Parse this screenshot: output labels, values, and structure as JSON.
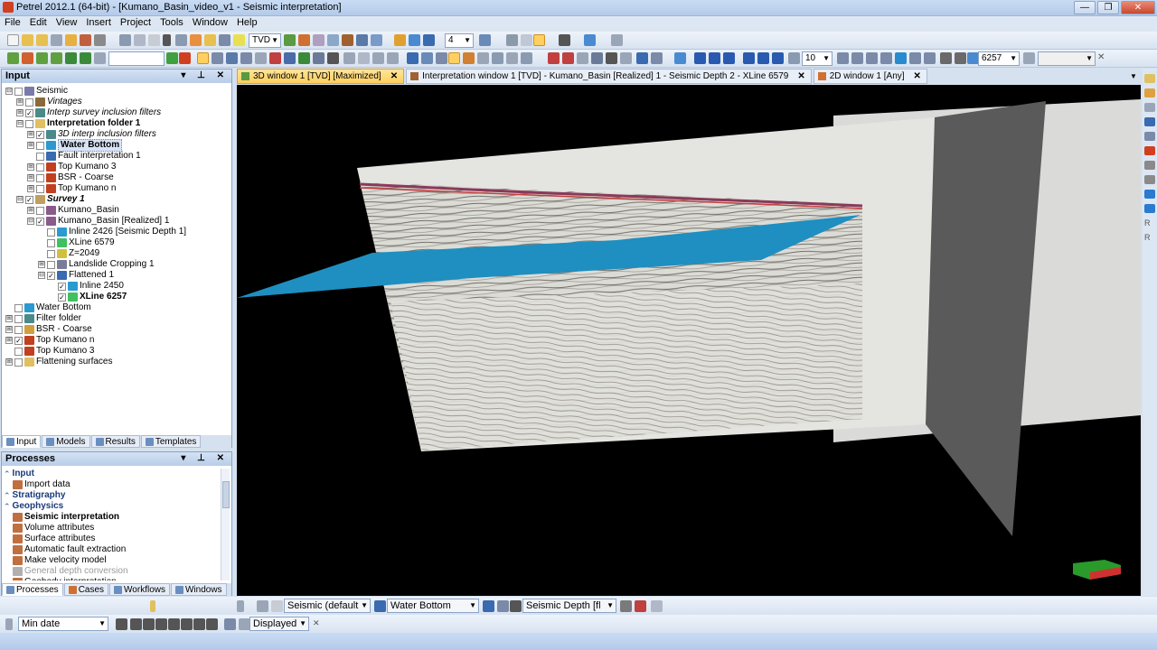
{
  "window": {
    "title": "Petrel 2012.1 (64-bit) - [Kumano_Basin_video_v1 - Seismic interpretation]",
    "minimize": "—",
    "maximize": "❐",
    "close": "✕"
  },
  "menu": [
    "File",
    "Edit",
    "View",
    "Insert",
    "Project",
    "Tools",
    "Window",
    "Help"
  ],
  "toolbar": {
    "domain_value": "TVD",
    "number_value": "4",
    "line_width_value": "10",
    "xline_value": "6257"
  },
  "input_panel": {
    "title": "Input",
    "controls": "▾ ⊥ ✕",
    "tree": [
      {
        "label": "Seismic",
        "indent": 0,
        "pm": "⊟",
        "chk": "",
        "icon": "#7a7aa8",
        "style": ""
      },
      {
        "label": "Vintages",
        "indent": 1,
        "pm": "⊞",
        "chk": "",
        "icon": "#8a6a3a",
        "style": "ital"
      },
      {
        "label": "Interp survey inclusion filters",
        "indent": 1,
        "pm": "⊞",
        "chk": "✓",
        "icon": "#4a8a8a",
        "style": "ital"
      },
      {
        "label": "Interpretation folder 1",
        "indent": 1,
        "pm": "⊟",
        "chk": "",
        "icon": "#e0c060",
        "style": "bold"
      },
      {
        "label": "3D interp inclusion filters",
        "indent": 2,
        "pm": "⊞",
        "chk": "✓",
        "icon": "#4a8a8a",
        "style": "ital"
      },
      {
        "label": "Water Bottom",
        "indent": 2,
        "pm": "⊞",
        "chk": "",
        "icon": "#2a9ad0",
        "style": "bold sel"
      },
      {
        "label": "Fault interpretation 1",
        "indent": 2,
        "pm": "",
        "chk": "",
        "icon": "#3a6ab0",
        "style": ""
      },
      {
        "label": "Top Kumano 3",
        "indent": 2,
        "pm": "⊞",
        "chk": "",
        "icon": "#c04020",
        "style": ""
      },
      {
        "label": "BSR - Coarse",
        "indent": 2,
        "pm": "⊞",
        "chk": "",
        "icon": "#c04020",
        "style": ""
      },
      {
        "label": "Top Kumano n",
        "indent": 2,
        "pm": "⊞",
        "chk": "",
        "icon": "#c04020",
        "style": ""
      },
      {
        "label": "Survey 1",
        "indent": 1,
        "pm": "⊟",
        "chk": "✓",
        "icon": "#c0a060",
        "style": "bold ital"
      },
      {
        "label": "Kumano_Basin",
        "indent": 2,
        "pm": "⊞",
        "chk": "",
        "icon": "#8a5a8a",
        "style": ""
      },
      {
        "label": "Kumano_Basin [Realized] 1",
        "indent": 2,
        "pm": "⊟",
        "chk": "✓",
        "icon": "#8a5a8a",
        "style": ""
      },
      {
        "label": "Inline 2426 [Seismic Depth 1]",
        "indent": 3,
        "pm": "",
        "chk": "",
        "icon": "#2a9ad0",
        "style": ""
      },
      {
        "label": "XLine 6579",
        "indent": 3,
        "pm": "",
        "chk": "",
        "icon": "#40c060",
        "style": ""
      },
      {
        "label": "Z=2049",
        "indent": 3,
        "pm": "",
        "chk": "",
        "icon": "#d0c040",
        "style": ""
      },
      {
        "label": "Landslide Cropping 1",
        "indent": 3,
        "pm": "⊞",
        "chk": "",
        "icon": "#7a7a9a",
        "style": ""
      },
      {
        "label": "Flattened 1",
        "indent": 3,
        "pm": "⊟",
        "chk": "✓",
        "icon": "#3a6ab0",
        "style": ""
      },
      {
        "label": "Inline 2450",
        "indent": 4,
        "pm": "",
        "chk": "✓",
        "icon": "#2a9ad0",
        "style": ""
      },
      {
        "label": "XLine 6257",
        "indent": 4,
        "pm": "",
        "chk": "✓",
        "icon": "#40c060",
        "style": "bold"
      },
      {
        "label": "Water Bottom",
        "indent": 0,
        "pm": "",
        "chk": "",
        "icon": "#2a9ad0",
        "style": ""
      },
      {
        "label": "Filter folder",
        "indent": 0,
        "pm": "⊞",
        "chk": "",
        "icon": "#4a8a8a",
        "style": ""
      },
      {
        "label": "BSR - Coarse",
        "indent": 0,
        "pm": "⊞",
        "chk": "",
        "icon": "#d0a040",
        "style": ""
      },
      {
        "label": "Top Kumano n",
        "indent": 0,
        "pm": "⊞",
        "chk": "✓",
        "icon": "#c04020",
        "style": ""
      },
      {
        "label": "Top Kumano 3",
        "indent": 0,
        "pm": "",
        "chk": "",
        "icon": "#c04020",
        "style": ""
      },
      {
        "label": "Flattening surfaces",
        "indent": 0,
        "pm": "⊞",
        "chk": "",
        "icon": "#e0c060",
        "style": ""
      }
    ],
    "tabs": [
      "Input",
      "Models",
      "Results",
      "Templates"
    ]
  },
  "processes_panel": {
    "title": "Processes",
    "controls": "▾ ⊥ ✕",
    "items": [
      {
        "label": "Input",
        "type": "group"
      },
      {
        "label": "Import data",
        "type": "item"
      },
      {
        "label": "Stratigraphy",
        "type": "group"
      },
      {
        "label": "Geophysics",
        "type": "group"
      },
      {
        "label": "Seismic interpretation",
        "type": "item-bold"
      },
      {
        "label": "Volume attributes",
        "type": "item"
      },
      {
        "label": "Surface attributes",
        "type": "item"
      },
      {
        "label": "Automatic fault extraction",
        "type": "item"
      },
      {
        "label": "Make velocity model",
        "type": "item"
      },
      {
        "label": "General depth conversion",
        "type": "item-dim"
      },
      {
        "label": "Geobody interpretation",
        "type": "item"
      }
    ],
    "tabs": [
      "Processes",
      "Cases",
      "Workflows",
      "Windows"
    ]
  },
  "doc_tabs": [
    {
      "label": "3D window 1 [TVD] [Maximized]",
      "active": true
    },
    {
      "label": "Interpretation window 1 [TVD] - Kumano_Basin [Realized] 1 - Seismic Depth 2 - XLine 6579",
      "active": false
    },
    {
      "label": "2D window 1 [Any]",
      "active": false
    }
  ],
  "doc_tab_close": "✕",
  "bottom_toolbar": {
    "seismic_template": "Seismic (default",
    "horizon": "Water Bottom",
    "seismic_depth": "Seismic Depth [fl",
    "date_mode": "Min date",
    "display_mode": "Displayed"
  }
}
